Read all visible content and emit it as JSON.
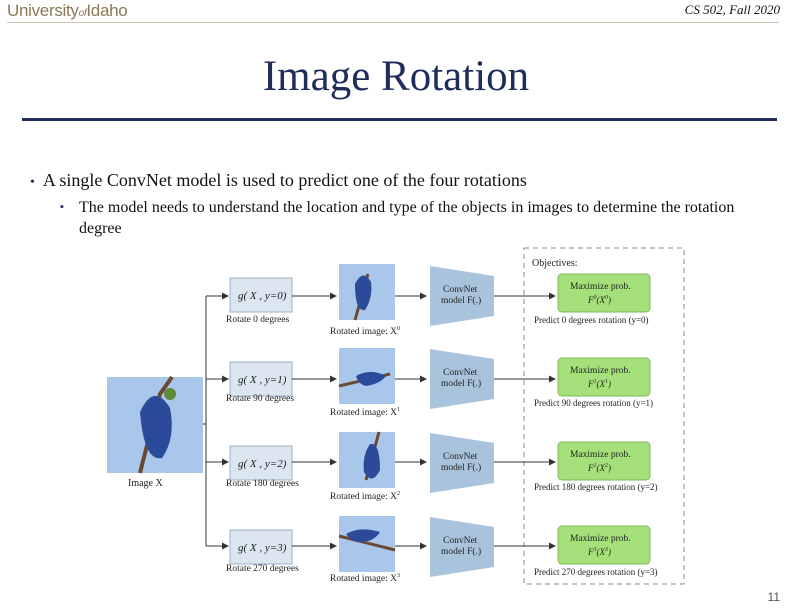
{
  "header": {
    "logo_main": "University",
    "logo_of": "of",
    "logo_end": "Idaho",
    "course": "CS 502, Fall 2020"
  },
  "title": "Image Rotation",
  "bullets": {
    "level1": "A single ConvNet model is used to predict one of the four rotations",
    "level2": "The model needs to understand the location and type of the objects in images to determine the rotation degree"
  },
  "figure": {
    "objectives_label": "Objectives:",
    "image_label": "Image X",
    "rows": [
      {
        "g": "g( X , y=0)",
        "rotate": "Rotate 0 degrees",
        "rotated": "Rotated image: X",
        "sup": "0",
        "convnet1": "ConvNet",
        "convnet2": "model F(.)",
        "max": "Maximize prob.",
        "prob": "F",
        "predict": "Predict 0 degrees rotation (y=0)"
      },
      {
        "g": "g( X , y=1)",
        "rotate": "Rotate 90 degrees",
        "rotated": "Rotated image: X",
        "sup": "1",
        "convnet1": "ConvNet",
        "convnet2": "model F(.)",
        "max": "Maximize prob.",
        "prob": "F",
        "predict": "Predict 90 degrees rotation (y=1)"
      },
      {
        "g": "g( X , y=2)",
        "rotate": "Rotate 180 degrees",
        "rotated": "Rotated image: X",
        "sup": "2",
        "convnet1": "ConvNet",
        "convnet2": "model F(.)",
        "max": "Maximize prob.",
        "prob": "F",
        "predict": "Predict 180 degrees rotation (y=2)"
      },
      {
        "g": "g( X , y=3)",
        "rotate": "Rotate 270 degrees",
        "rotated": "Rotated image: X",
        "sup": "3",
        "convnet1": "ConvNet",
        "convnet2": "model F(.)",
        "max": "Maximize prob.",
        "prob": "F",
        "predict": "Predict 270 degrees rotation (y=3)"
      }
    ],
    "colors": {
      "g_box": "#dce6f0",
      "convnet": "#a9c3dc",
      "objective": "#a6e07a",
      "sky": "#a9c7ea",
      "bird": "#2b4a9a",
      "branch": "#6b4a34",
      "leaf": "#5f8a3a"
    }
  },
  "page_number": "11"
}
